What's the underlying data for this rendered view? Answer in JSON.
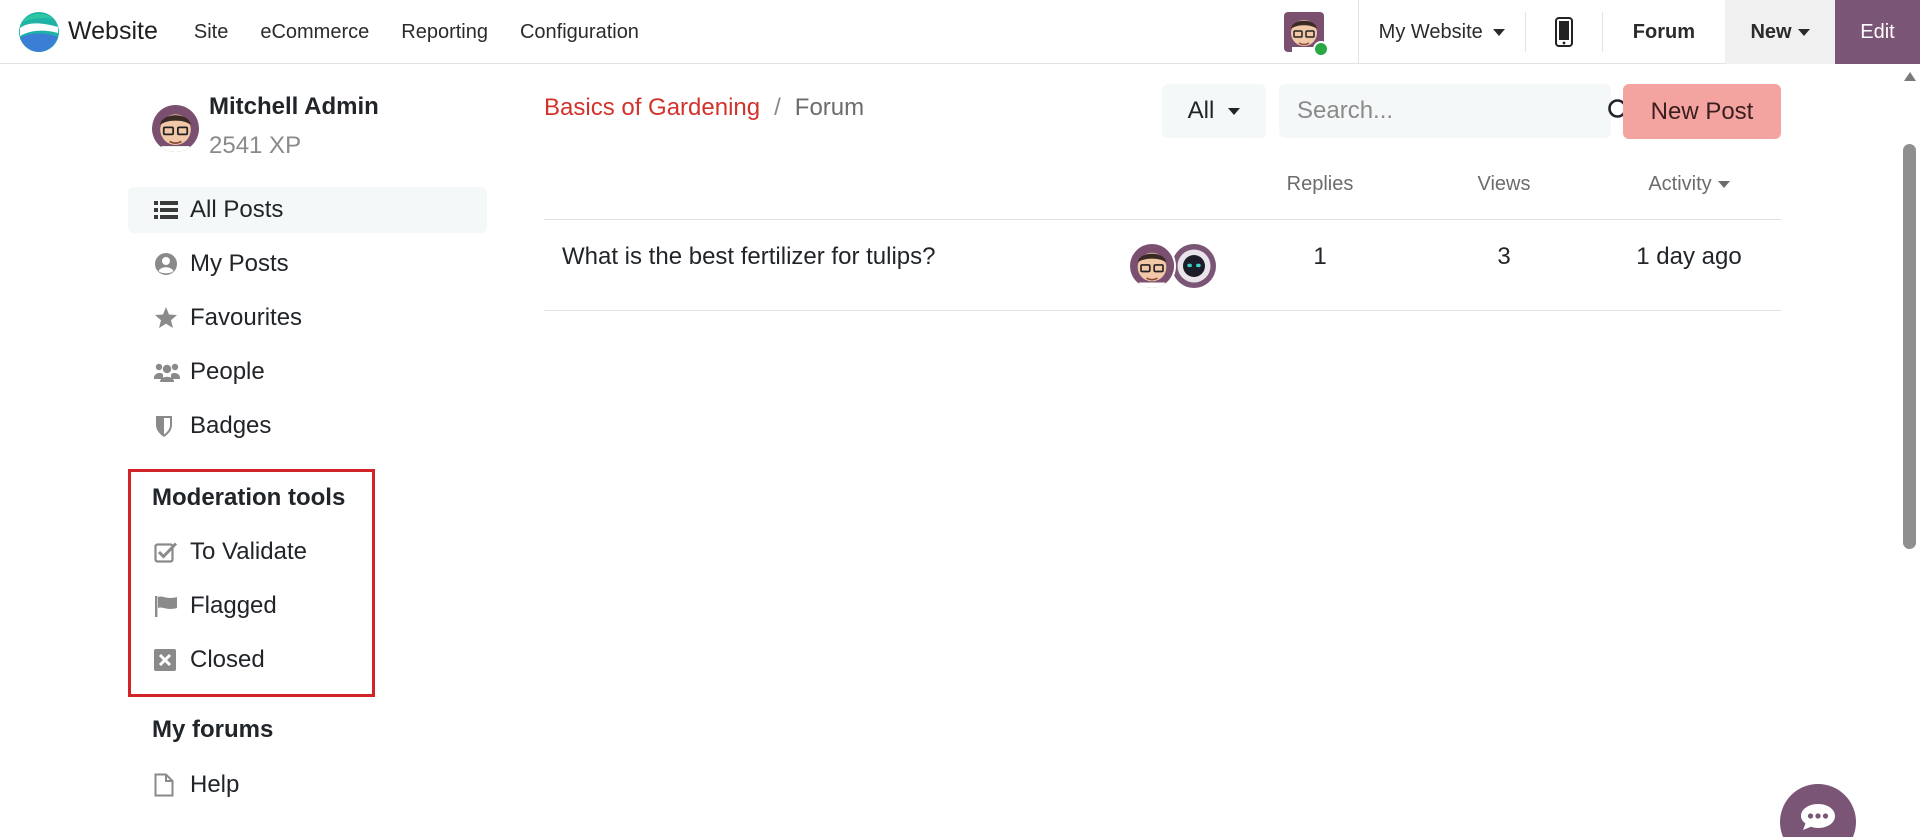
{
  "navbar": {
    "brand_name": "Website",
    "menu": [
      "Site",
      "eCommerce",
      "Reporting",
      "Configuration"
    ],
    "website_selector": "My Website",
    "forum_label": "Forum",
    "new_label": "New",
    "edit_label": "Edit"
  },
  "sidebar": {
    "user_name": "Mitchell Admin",
    "user_xp": "2541 XP",
    "nav_items": [
      {
        "label": "All Posts",
        "icon": "list-icon"
      },
      {
        "label": "My Posts",
        "icon": "user-circle-icon"
      },
      {
        "label": "Favourites",
        "icon": "star-icon"
      },
      {
        "label": "People",
        "icon": "users-icon"
      },
      {
        "label": "Badges",
        "icon": "shield-icon"
      }
    ],
    "moderation_heading": "Moderation tools",
    "moderation_items": [
      {
        "label": "To Validate",
        "icon": "check-square-icon"
      },
      {
        "label": "Flagged",
        "icon": "flag-icon"
      },
      {
        "label": "Closed",
        "icon": "close-square-icon"
      }
    ],
    "my_forums_heading": "My forums",
    "forums": [
      {
        "label": "Help",
        "icon": "file-icon"
      }
    ],
    "highlight_color": "#d22327"
  },
  "main": {
    "breadcrumb": {
      "parent": "Basics of Gardening",
      "current": "Forum"
    },
    "filter_label": "All",
    "search_placeholder": "Search...",
    "new_post_label": "New Post",
    "columns": {
      "replies": "Replies",
      "views": "Views",
      "activity": "Activity"
    },
    "posts": [
      {
        "title": "What is the best fertilizer for tulips?",
        "replies": "1",
        "views": "3",
        "activity": "1 day ago"
      }
    ]
  },
  "colors": {
    "brand_purple": "#7b5575",
    "link_red": "#d2332b",
    "new_post_bg": "#f4a4a0",
    "online_green": "#28a745"
  }
}
